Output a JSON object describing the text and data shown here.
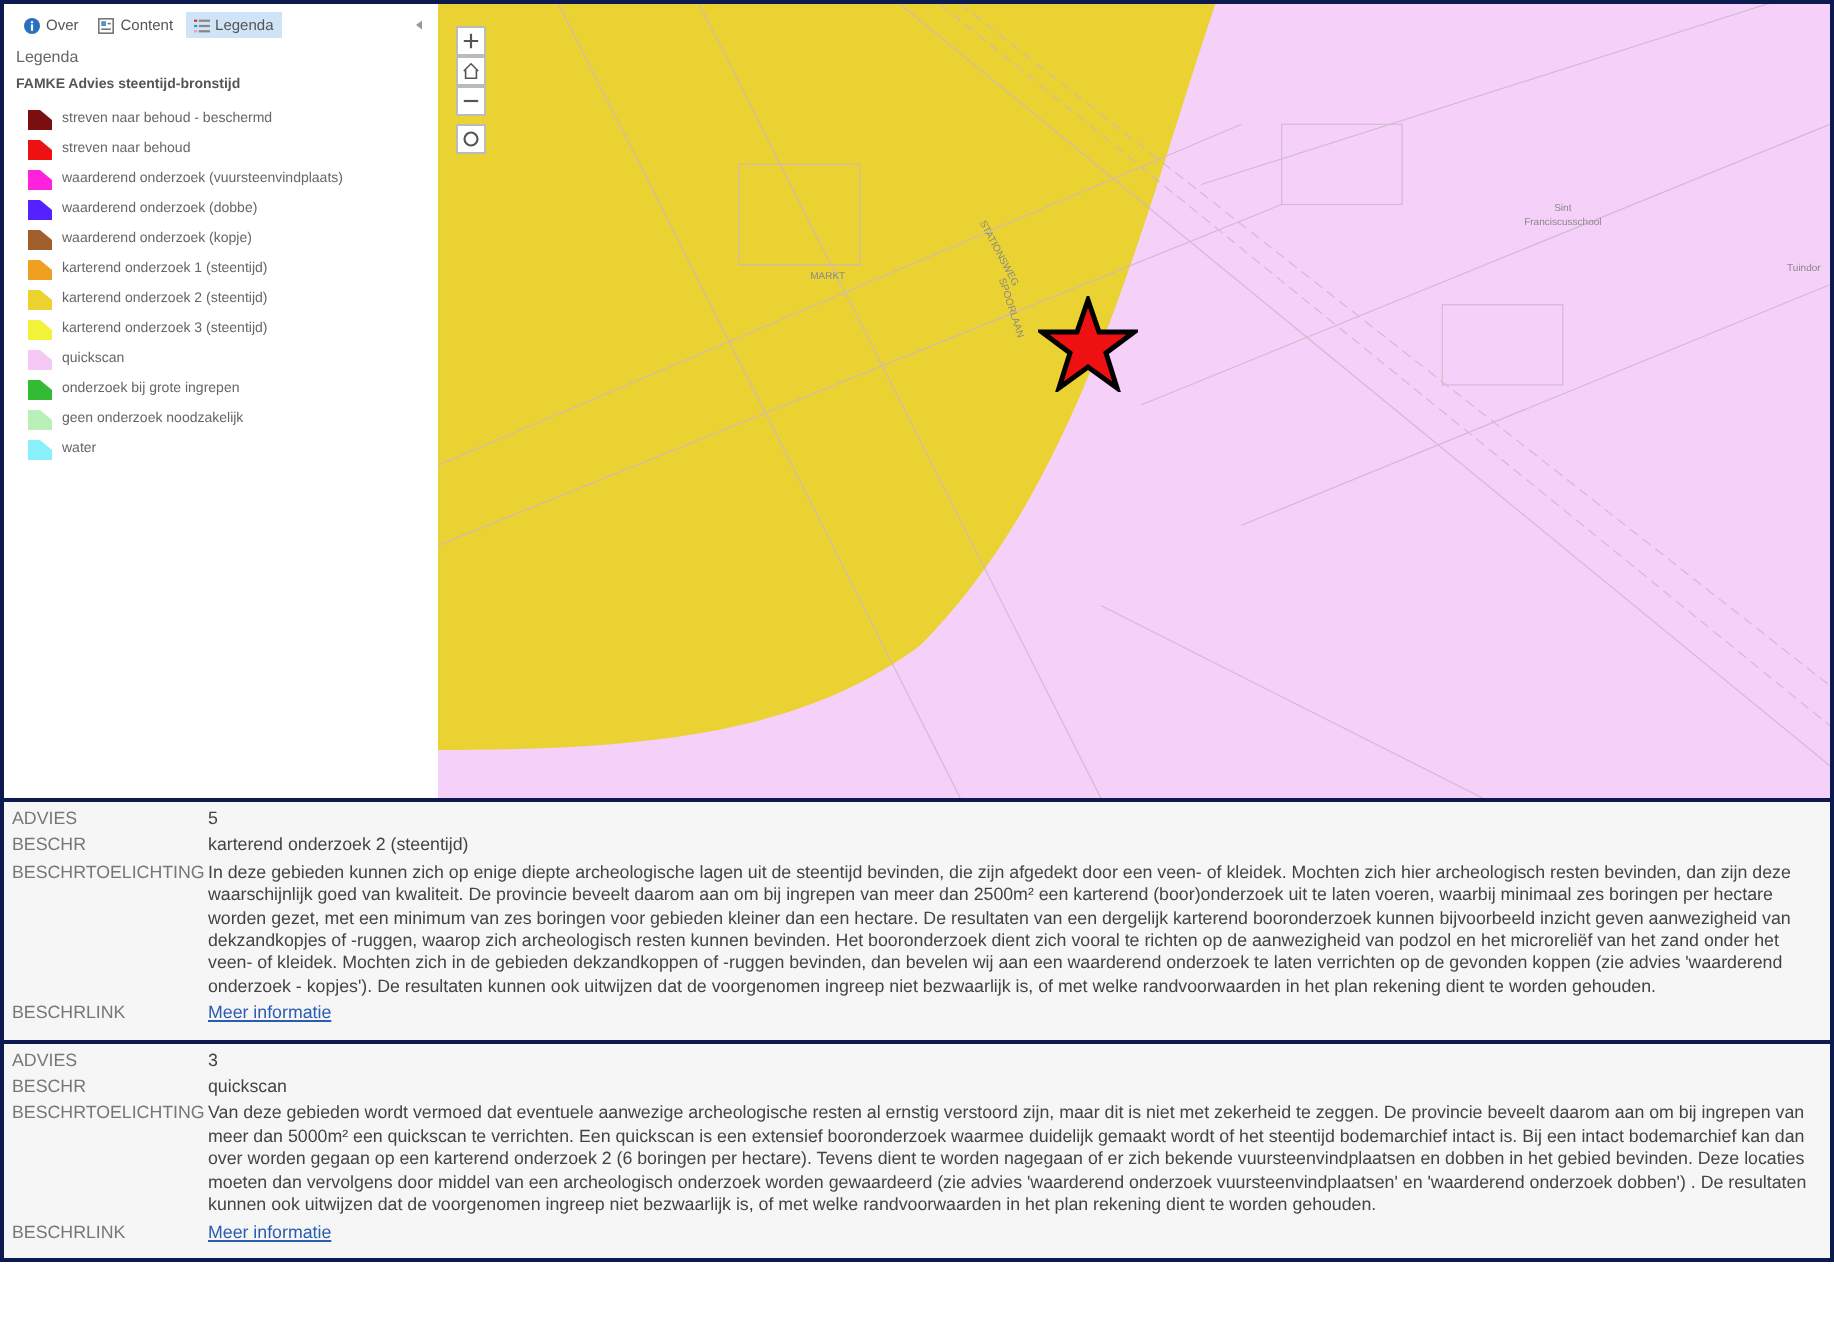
{
  "sidebar": {
    "tabs": [
      {
        "label": "Over",
        "selected": false
      },
      {
        "label": "Content",
        "selected": false
      },
      {
        "label": "Legenda",
        "selected": true
      }
    ],
    "heading": "Legenda",
    "layer_title": "FAMKE Advies steentijd-bronstijd",
    "legend": [
      {
        "label": "streven naar behoud - beschermd",
        "color": "#7b0f0f"
      },
      {
        "label": "streven naar behoud",
        "color": "#ee1111"
      },
      {
        "label": "waarderend onderzoek (vuursteenvindplaats)",
        "color": "#ff22dd"
      },
      {
        "label": "waarderend onderzoek (dobbe)",
        "color": "#5522ff"
      },
      {
        "label": "waarderend onderzoek (kopje)",
        "color": "#a0602e"
      },
      {
        "label": "karterend onderzoek 1 (steentijd)",
        "color": "#f0a020"
      },
      {
        "label": "karterend onderzoek 2 (steentijd)",
        "color": "#ecd22e"
      },
      {
        "label": "karterend onderzoek 3 (steentijd)",
        "color": "#f2f23a"
      },
      {
        "label": "quickscan",
        "color": "#f6c8f6"
      },
      {
        "label": "onderzoek bij grote ingrepen",
        "color": "#33bb33"
      },
      {
        "label": "geen onderzoek noodzakelijk",
        "color": "#b8f0b8"
      },
      {
        "label": "water",
        "color": "#88f0f8"
      }
    ]
  },
  "map": {
    "labels": [
      {
        "text": "MARKT"
      },
      {
        "text": "STATIONSWEG"
      },
      {
        "text": "SPOORLAAN"
      },
      {
        "text": "Sint"
      },
      {
        "text": "Franciscusschool"
      },
      {
        "text": "Tuindor"
      }
    ]
  },
  "popups": [
    {
      "fields": [
        {
          "label": "ADVIES",
          "value": "5",
          "kind": "text"
        },
        {
          "label": "BESCHR",
          "value": "karterend onderzoek 2 (steentijd)",
          "kind": "text"
        },
        {
          "label": "BESCHRTOELICHTING",
          "value": "In deze gebieden kunnen zich op enige diepte archeologische lagen uit de steentijd bevinden, die zijn afgedekt door een veen- of kleidek. Mochten zich hier archeologisch resten bevinden, dan zijn deze waarschijnlijk goed van kwaliteit. De provincie beveelt daarom aan om bij ingrepen van meer dan 2500m² een karterend (boor)onderzoek uit te laten voeren, waarbij minimaal zes boringen per hectare worden gezet, met een minimum van zes boringen voor gebieden kleiner dan een hectare. De resultaten van een dergelijk karterend booronderzoek kunnen bijvoorbeeld inzicht geven aanwezigheid van dekzandkopjes of -ruggen, waarop zich archeologisch resten kunnen bevinden. Het booronderzoek dient zich vooral te richten op de aanwezigheid van podzol en het microreliëf van het zand onder het veen- of kleidek. Mochten zich in de gebieden dekzandkoppen of -ruggen bevinden, dan bevelen wij aan een waarderend onderzoek te laten verrichten op de gevonden koppen (zie advies 'waarderend onderzoek - kopjes'). De resultaten kunnen ook uitwijzen dat de voorgenomen ingreep niet bezwaarlijk is, of met welke randvoorwaarden in het plan rekening dient te worden gehouden.",
          "kind": "text"
        },
        {
          "label": "BESCHRLINK",
          "value": "Meer informatie",
          "kind": "link"
        }
      ]
    },
    {
      "fields": [
        {
          "label": "ADVIES",
          "value": "3",
          "kind": "text"
        },
        {
          "label": "BESCHR",
          "value": "quickscan",
          "kind": "text"
        },
        {
          "label": "BESCHRTOELICHTING",
          "value": "Van deze gebieden wordt vermoed dat eventuele aanwezige archeologische resten al ernstig verstoord zijn, maar dit is niet met zekerheid te zeggen. De provincie beveelt daarom aan om bij ingrepen van meer dan 5000m² een quickscan te verrichten. Een quickscan is een extensief booronderzoek waarmee duidelijk gemaakt wordt of het steentijd bodemarchief intact is. Bij een intact bodemarchief kan dan over worden gegaan op een karterend onderzoek 2 (6 boringen per hectare). Tevens dient te worden nagegaan of er zich bekende vuursteenvindplaatsen en dobben in het gebied bevinden. Deze locaties moeten dan vervolgens door middel van een archeologisch onderzoek worden gewaardeerd (zie advies 'waarderend onderzoek vuursteenvindplaatsen' en 'waarderend onderzoek dobben') . De resultaten kunnen ook uitwijzen dat de voorgenomen ingreep niet bezwaarlijk is, of met welke randvoorwaarden in het plan rekening dient te worden gehouden.",
          "kind": "text"
        },
        {
          "label": "BESCHRLINK",
          "value": "Meer informatie",
          "kind": "link"
        }
      ]
    }
  ]
}
